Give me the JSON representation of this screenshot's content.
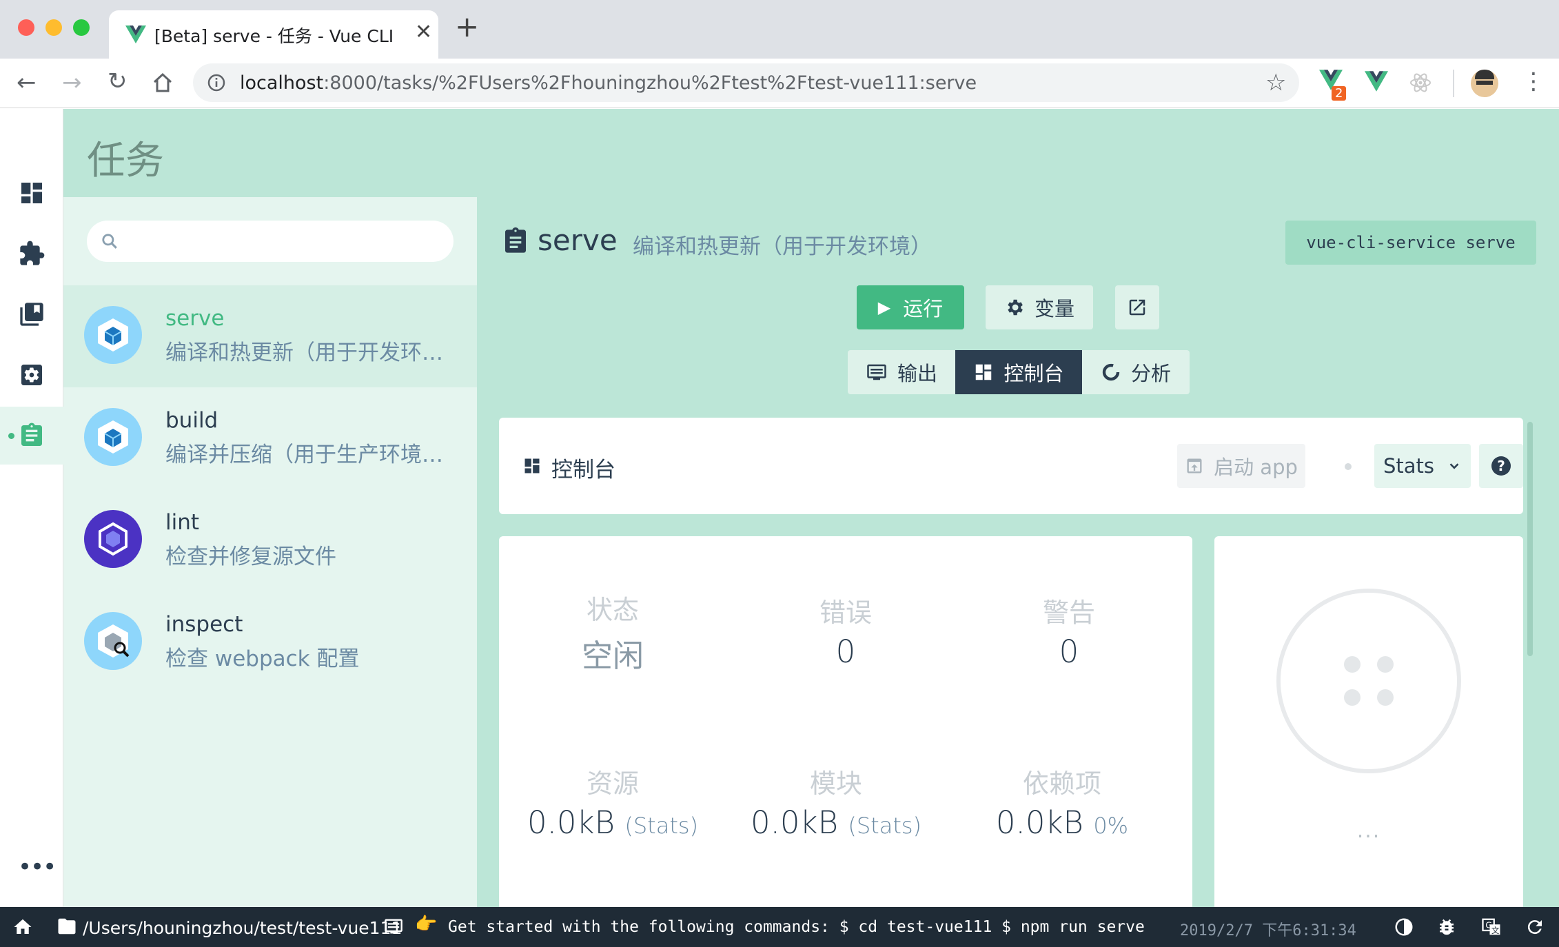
{
  "browser": {
    "tab_title": "[Beta] serve - 任务 - Vue CLI",
    "url_host": "localhost",
    "url_rest": ":8000/tasks/%2FUsers%2Fhouningzhou%2Ftest%2Ftest-vue111:serve",
    "ext_badge": "2"
  },
  "app": {
    "page_title": "任务",
    "search": {
      "placeholder": ""
    },
    "tasks": [
      {
        "name": "serve",
        "description": "编译和热更新（用于开发环…",
        "selected": true
      },
      {
        "name": "build",
        "description": "编译并压缩（用于生产环境…"
      },
      {
        "name": "lint",
        "description": "检查并修复源文件"
      },
      {
        "name": "inspect",
        "description": "检查 webpack 配置"
      }
    ],
    "task_header": {
      "name": "serve",
      "description": "编译和热更新（用于开发环境）",
      "command": "vue-cli-service serve"
    },
    "actions": {
      "run": "运行",
      "variables": "变量"
    },
    "view_tabs": [
      {
        "label": "输出"
      },
      {
        "label": "控制台",
        "active": true
      },
      {
        "label": "分析"
      }
    ],
    "dashboard": {
      "title": "控制台",
      "open_app": "启动 app",
      "stats_select": "Stats",
      "help": "?"
    },
    "stats": [
      {
        "label": "状态",
        "value": "空闲",
        "unit": ""
      },
      {
        "label": "错误",
        "value": "0",
        "unit": ""
      },
      {
        "label": "警告",
        "value": "0",
        "unit": ""
      },
      {
        "label": "资源",
        "value": "0.0kB",
        "unit": "(Stats)"
      },
      {
        "label": "模块",
        "value": "0.0kB",
        "unit": "(Stats)"
      },
      {
        "label": "依赖项",
        "value": "0.0kB",
        "unit": "0%"
      }
    ],
    "progress": {
      "label": "..."
    }
  },
  "statusbar": {
    "path": "/Users/houningzhou/test/test-vue111",
    "log_message": "Get started with the following commands: $ cd test-vue111 $ npm run serve",
    "log_time": "2019/2/7 下午6:31:34"
  },
  "colors": {
    "accent": "#42b983",
    "dark": "#2c3e50",
    "header": "#bce6d7"
  }
}
